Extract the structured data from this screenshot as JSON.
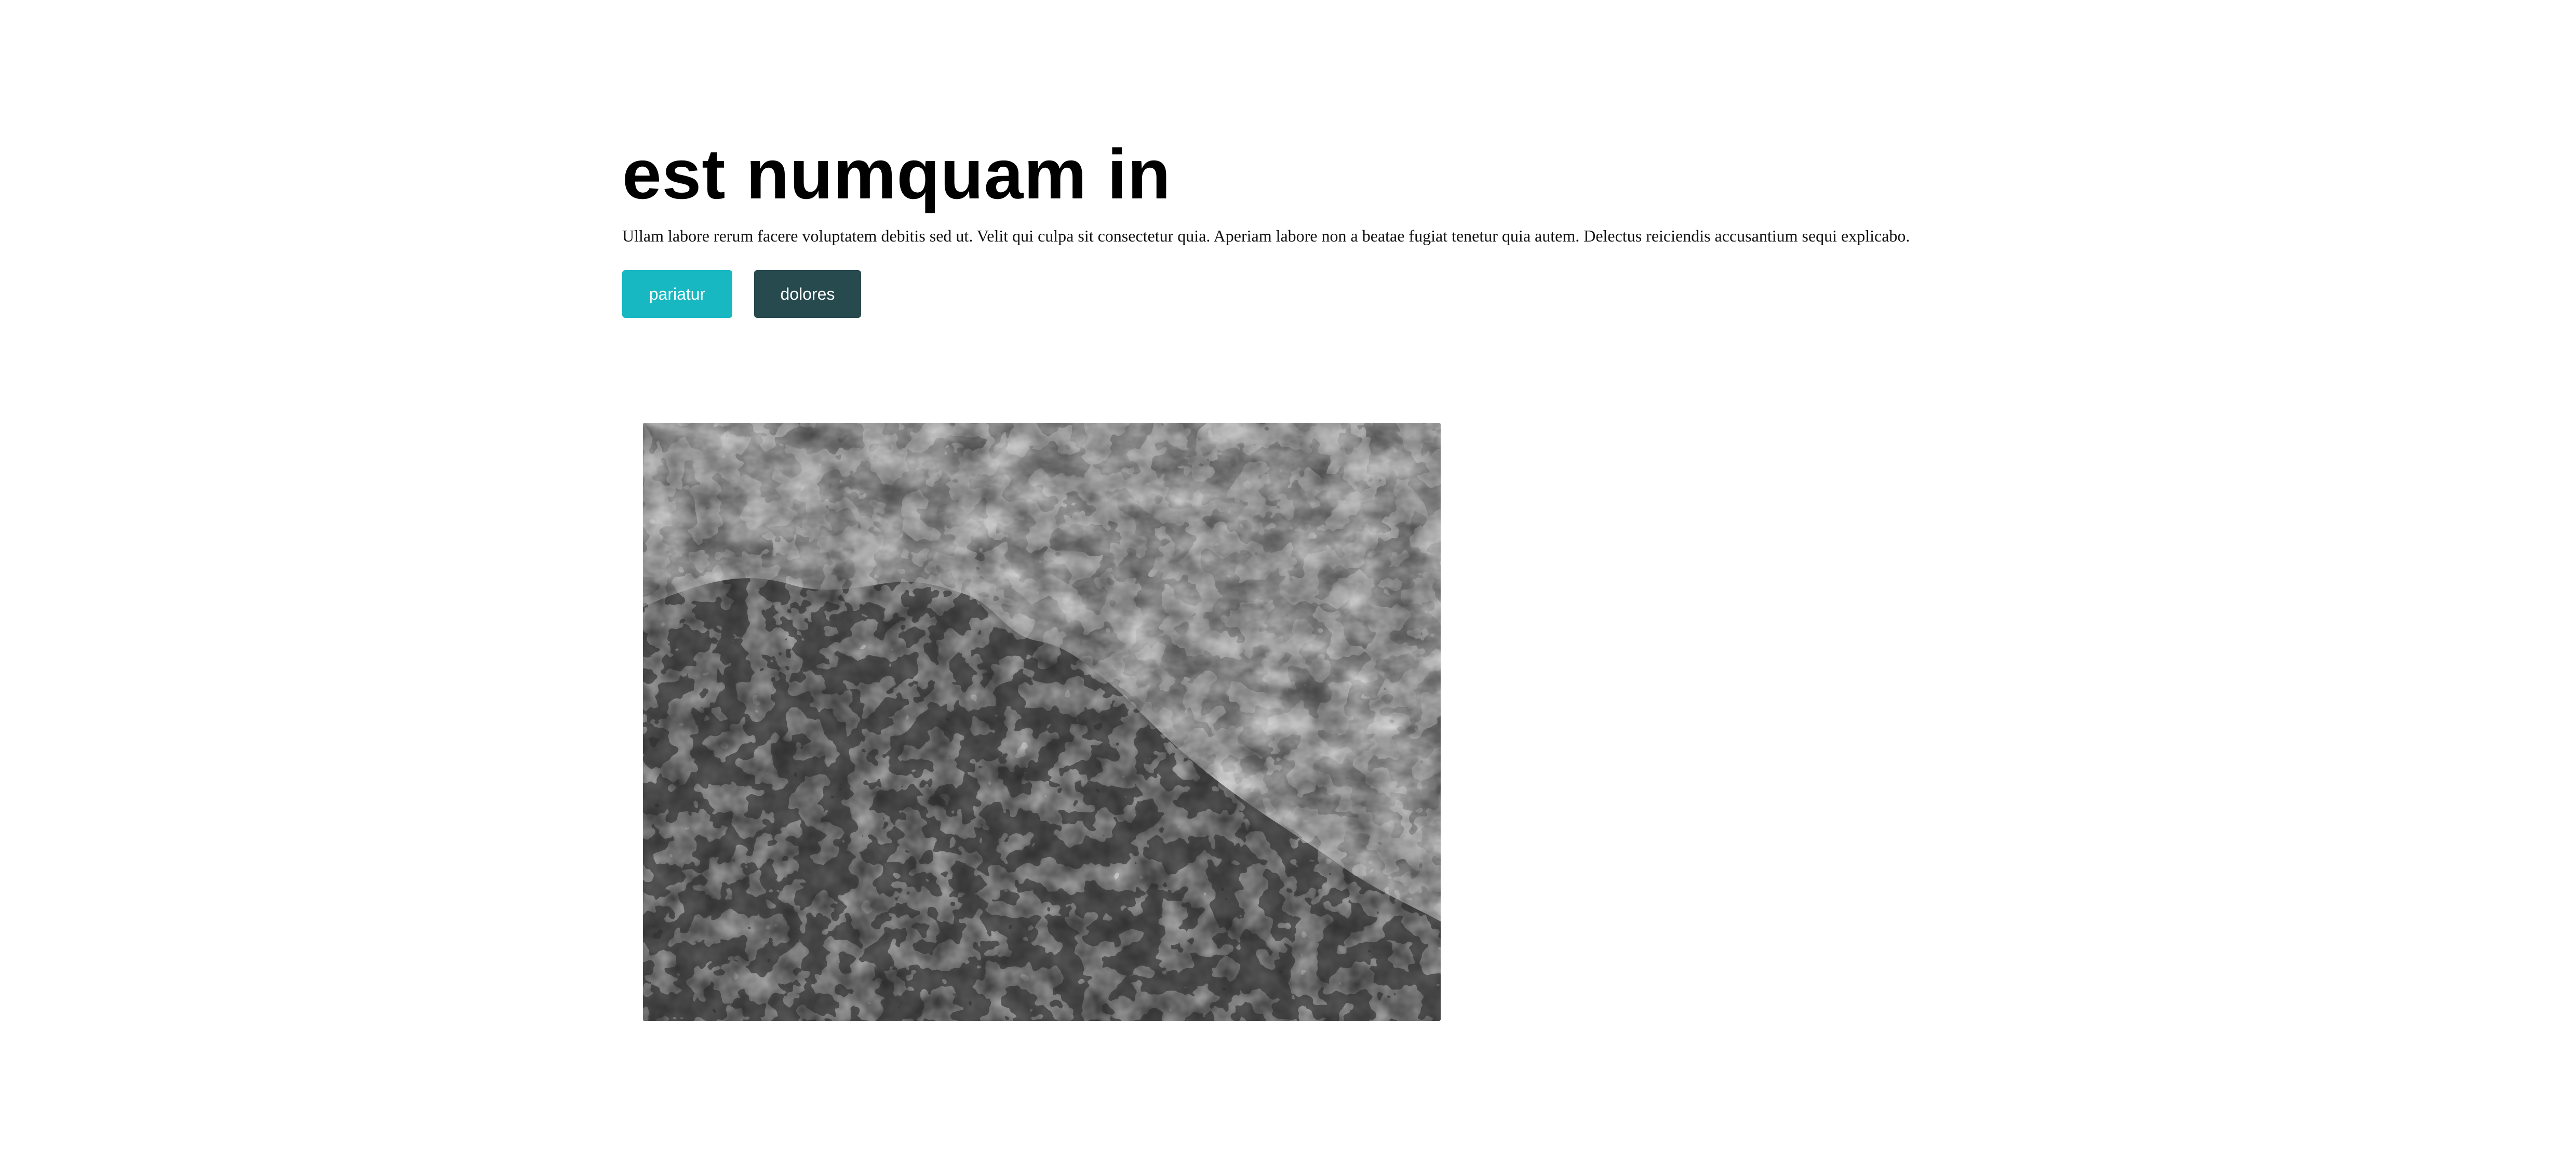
{
  "hero": {
    "title": "est numquam in",
    "description": "Ullam labore rerum facere voluptatem debitis sed ut. Velit qui culpa sit consectetur quia. Aperiam labore non a beatae fugiat tenetur quia autem. Delectus reiciendis accusantium sequi explicabo.",
    "buttons": {
      "primary_label": "pariatur",
      "secondary_label": "dolores"
    }
  },
  "colors": {
    "primary_button": "#17b8c2",
    "secondary_button": "#274a4f"
  },
  "media": {
    "alt": "ocean wave foam"
  }
}
